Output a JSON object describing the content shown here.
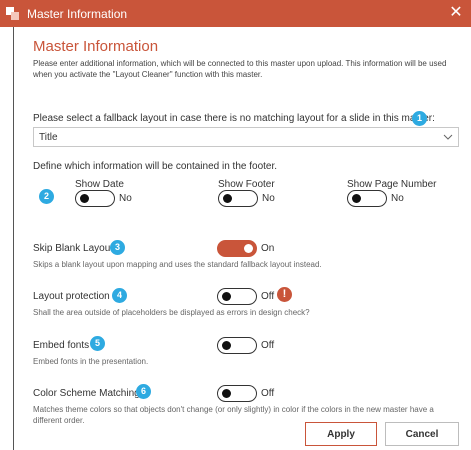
{
  "window": {
    "title": "Master Information",
    "close_glyph": "✕"
  },
  "heading": "Master Information",
  "intro": "Please enter additional information, which will be connected to this master upon upload. This information will be used when you activate the \"Layout Cleaner\" function with this master.",
  "fallback": {
    "label": "Please select a fallback layout in case there is no matching layout for a slide in this master:",
    "badge": "1",
    "value": "Title"
  },
  "footer": {
    "label": "Define which information will be contained in the footer.",
    "badge": "2",
    "options": [
      {
        "label": "Show Date",
        "state": "No"
      },
      {
        "label": "Show Footer",
        "state": "No"
      },
      {
        "label": "Show Page Number",
        "state": "No"
      }
    ]
  },
  "settings": [
    {
      "title": "Skip Blank Layout",
      "badge": "3",
      "state": "On",
      "desc": "Skips a blank layout upon mapping and uses the standard fallback layout instead."
    },
    {
      "title": "Layout protection",
      "badge": "4",
      "state": "Off",
      "warning": "!",
      "desc": "Shall the area outside of placeholders be displayed as errors in design check?"
    },
    {
      "title": "Embed fonts",
      "badge": "5",
      "state": "Off",
      "desc": "Embed fonts in the presentation."
    },
    {
      "title": "Color Scheme Matching",
      "badge": "6",
      "state": "Off",
      "desc": "Matches theme colors so that objects don't change (or only slightly) in color if the colors in the new master have a different order."
    }
  ],
  "buttons": {
    "apply": "Apply",
    "cancel": "Cancel"
  },
  "colors": {
    "accent": "#c9553a",
    "badge": "#2eaae1"
  }
}
